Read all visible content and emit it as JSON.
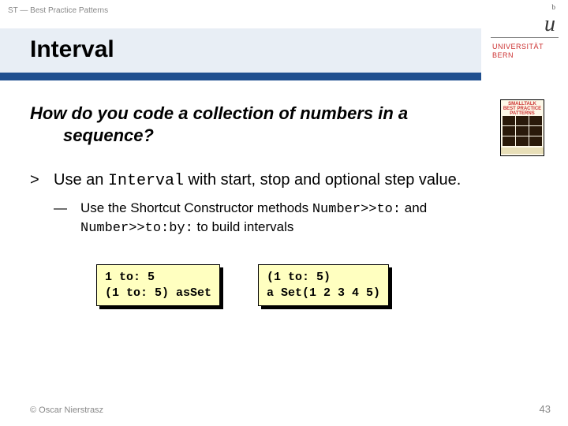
{
  "header": {
    "breadcrumb": "ST — Best Practice Patterns"
  },
  "logo": {
    "letter_sup": "b",
    "letter_main": "u",
    "line1": "UNIVERSITÄT",
    "line2": "BERN"
  },
  "title": "Interval",
  "question": {
    "line1": "How do you code a collection of numbers in a",
    "line2": "sequence?"
  },
  "book": {
    "top1": "SMALLTALK",
    "top2": "BEST PRACTICE",
    "top3": "PATTERNS"
  },
  "bullet": {
    "mark": ">",
    "pre": "Use an ",
    "code": "Interval",
    "post": " with start, stop and optional step value."
  },
  "sub": {
    "mark": "—",
    "t1": "Use the Shortcut Constructor methods ",
    "c1": "Number>>to:",
    "t2": " and ",
    "c2": "Number>>to:by:",
    "t3": " to build intervals"
  },
  "code_left": "1 to: 5\n(1 to: 5) asSet",
  "code_right": "(1 to: 5)\na Set(1 2 3 4 5)",
  "footer": {
    "copyright": "© Oscar Nierstrasz",
    "page": "43"
  }
}
